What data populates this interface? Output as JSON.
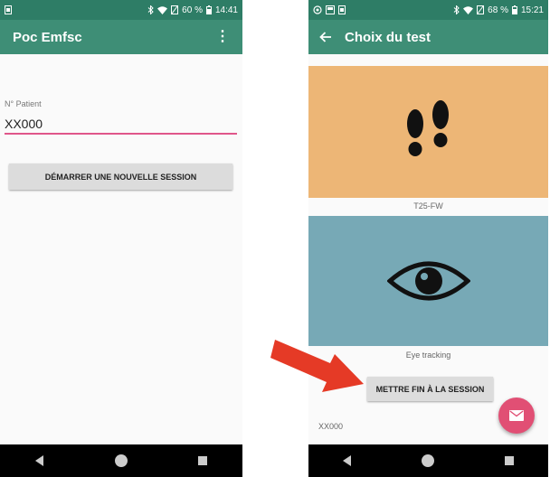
{
  "left_screen": {
    "status": {
      "battery": "60 %",
      "time": "14:41"
    },
    "app_title": "Poc Emfsc",
    "menu_icon": "more-vert-icon",
    "field_label": "N° Patient",
    "patient_value": "XX000",
    "start_button": "DÉMARRER UNE NOUVELLE SESSION"
  },
  "right_screen": {
    "status": {
      "battery": "68 %",
      "time": "15:21"
    },
    "title": "Choix du test",
    "tests": [
      {
        "label": "T25-FW",
        "icon": "footprints-icon",
        "color": "#edb676"
      },
      {
        "label": "Eye tracking",
        "icon": "eye-icon",
        "color": "#77a9b6"
      }
    ],
    "end_button": "METTRE FIN À LA SESSION",
    "patient_id": "XX000",
    "fab_icon": "mail-icon"
  },
  "colors": {
    "status_bar": "#2e7d66",
    "app_bar": "#3e8e76",
    "accent": "#e14f74",
    "arrow": "#e53a26"
  }
}
